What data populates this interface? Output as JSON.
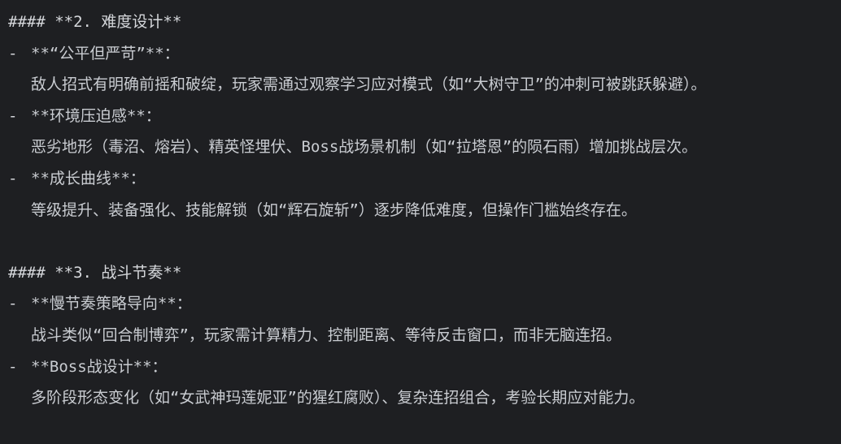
{
  "section2": {
    "heading": "#### **2. 难度设计**",
    "items": [
      {
        "dash": "-",
        "title": "**“公平但严苛”**：",
        "body": "敌人招式有明确前摇和破绽，玩家需通过观察学习应对模式（如“大树守卫”的冲刺可被跳跃躲避）。"
      },
      {
        "dash": "-",
        "title": "**环境压迫感**：",
        "body": "恶劣地形（毒沼、熔岩）、精英怪埋伏、Boss战场景机制（如“拉塔恩”的陨石雨）增加挑战层次。"
      },
      {
        "dash": "-",
        "title": "**成长曲线**：",
        "body": "等级提升、装备强化、技能解锁（如“辉石旋斩”）逐步降低难度，但操作门槛始终存在。"
      }
    ]
  },
  "section3": {
    "heading": "#### **3. 战斗节奏**",
    "items": [
      {
        "dash": "-",
        "title": "**慢节奏策略导向**：",
        "body": "战斗类似“回合制博弈”，玩家需计算精力、控制距离、等待反击窗口，而非无脑连招。"
      },
      {
        "dash": "-",
        "title": "**Boss战设计**：",
        "body": "多阶段形态变化（如“女武神玛莲妮亚”的猩红腐败）、复杂连招组合，考验长期应对能力。"
      }
    ]
  }
}
